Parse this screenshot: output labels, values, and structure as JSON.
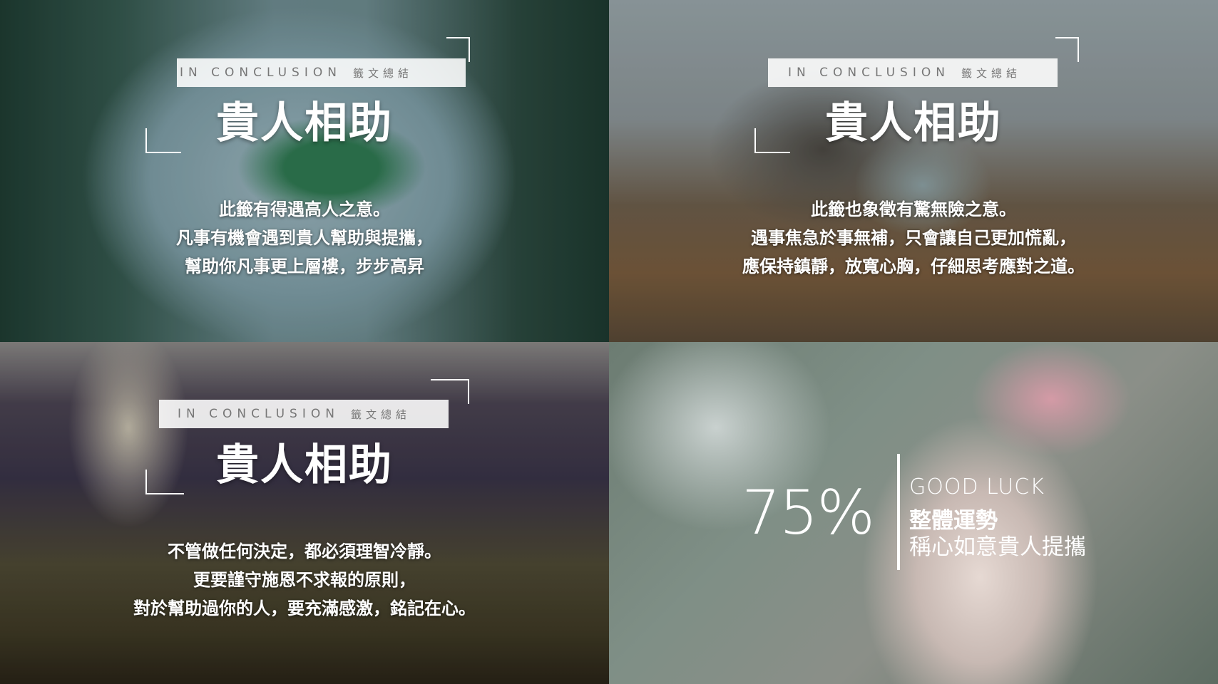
{
  "panels": [
    {
      "label_en": "IN CONCLUSION",
      "label_cn": "籤文總結",
      "title": "貴人相助",
      "lines": [
        "此籤有得遇高人之意。",
        "凡事有機會遇到貴人幫助與提攜，",
        "幫助你凡事更上層樓，步步高昇"
      ]
    },
    {
      "label_en": "IN CONCLUSION",
      "label_cn": "籤文總結",
      "title": "貴人相助",
      "lines": [
        "此籤也象徵有驚無險之意。",
        "遇事焦急於事無補，只會讓自己更加慌亂，",
        "應保持鎮靜，放寬心胸，仔細思考應對之道。"
      ]
    },
    {
      "label_en": "IN CONCLUSION",
      "label_cn": "籤文總結",
      "title": "貴人相助",
      "lines": [
        "不管做任何決定，都必須理智冷靜。",
        "更要謹守施恩不求報的原則，",
        "對於幫助過你的人，要充滿感激，銘記在心。"
      ]
    }
  ],
  "summary": {
    "percent": "75%",
    "heading_en": "GOOD LUCK",
    "heading_cn": "整體運勢",
    "description": "稱心如意貴人提攜"
  }
}
